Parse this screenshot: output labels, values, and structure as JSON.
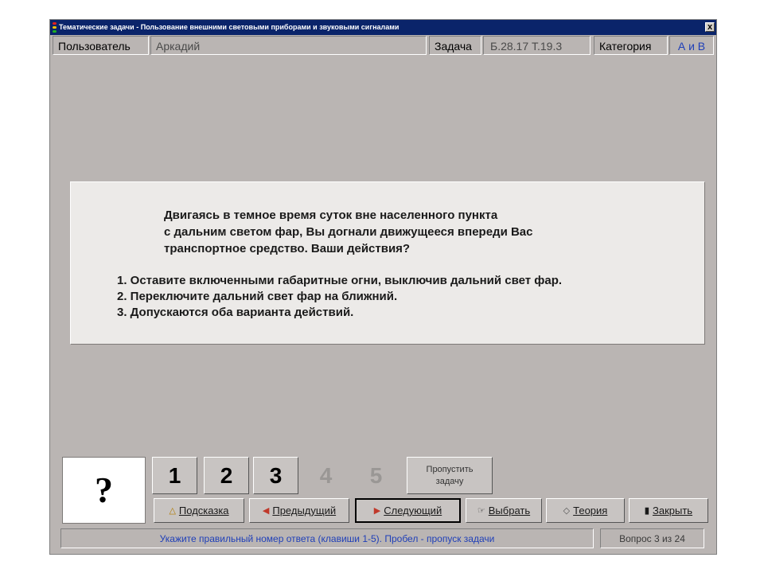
{
  "window": {
    "title": "Тематические задачи - Пользование внешними световыми приборами и звуковыми сигналами",
    "close_glyph": "x"
  },
  "header": {
    "user_label": "Пользователь",
    "user_value": "Аркадий",
    "task_label": "Задача",
    "task_value": "Б.28.17  Т.19.3",
    "category_label": "Категория",
    "category_value": "А и В"
  },
  "question": {
    "lines": [
      "Двигаясь в темное время суток вне населенного пункта",
      "с дальним светом фар, Вы догнали движущееся впереди Вас",
      "транспортное средство. Ваши действия?"
    ]
  },
  "answers": [
    "1. Оставите включенными габаритные огни, выключив дальний свет фар.",
    "2. Переключите дальний свет фар на ближний.",
    "3. Допускаются оба варианта действий."
  ],
  "answer_indicator": "?",
  "number_buttons": [
    {
      "label": "1",
      "enabled": true
    },
    {
      "label": "2",
      "enabled": true
    },
    {
      "label": "3",
      "enabled": true
    },
    {
      "label": "4",
      "enabled": false
    },
    {
      "label": "5",
      "enabled": false
    }
  ],
  "skip_button": {
    "line1": "Пропустить",
    "line2": "задачу"
  },
  "actions": {
    "hint": "Подсказка",
    "previous": "Предыдущий",
    "next": "Следующий",
    "select": "Выбрать",
    "theory": "Теория",
    "close": "Закрыть"
  },
  "icons": {
    "hint": "hint-bell-icon",
    "previous": "arrow-left-icon",
    "next": "arrow-right-icon",
    "select": "select-hand-icon",
    "theory": "theory-book-icon",
    "close": "exit-door-icon"
  },
  "status": {
    "hint_text": "Укажите правильный номер ответа (клавиши 1-5). Пробел - пропуск задачи",
    "progress": "Вопрос 3 из 24",
    "current_question": 3,
    "total_questions": 24
  },
  "colors": {
    "window_bg": "#bab5b3",
    "titlebar": "#0a246a",
    "panel_bg": "#eceae8",
    "status_text": "#1f3fb8",
    "arrow_red": "#c0392b"
  }
}
